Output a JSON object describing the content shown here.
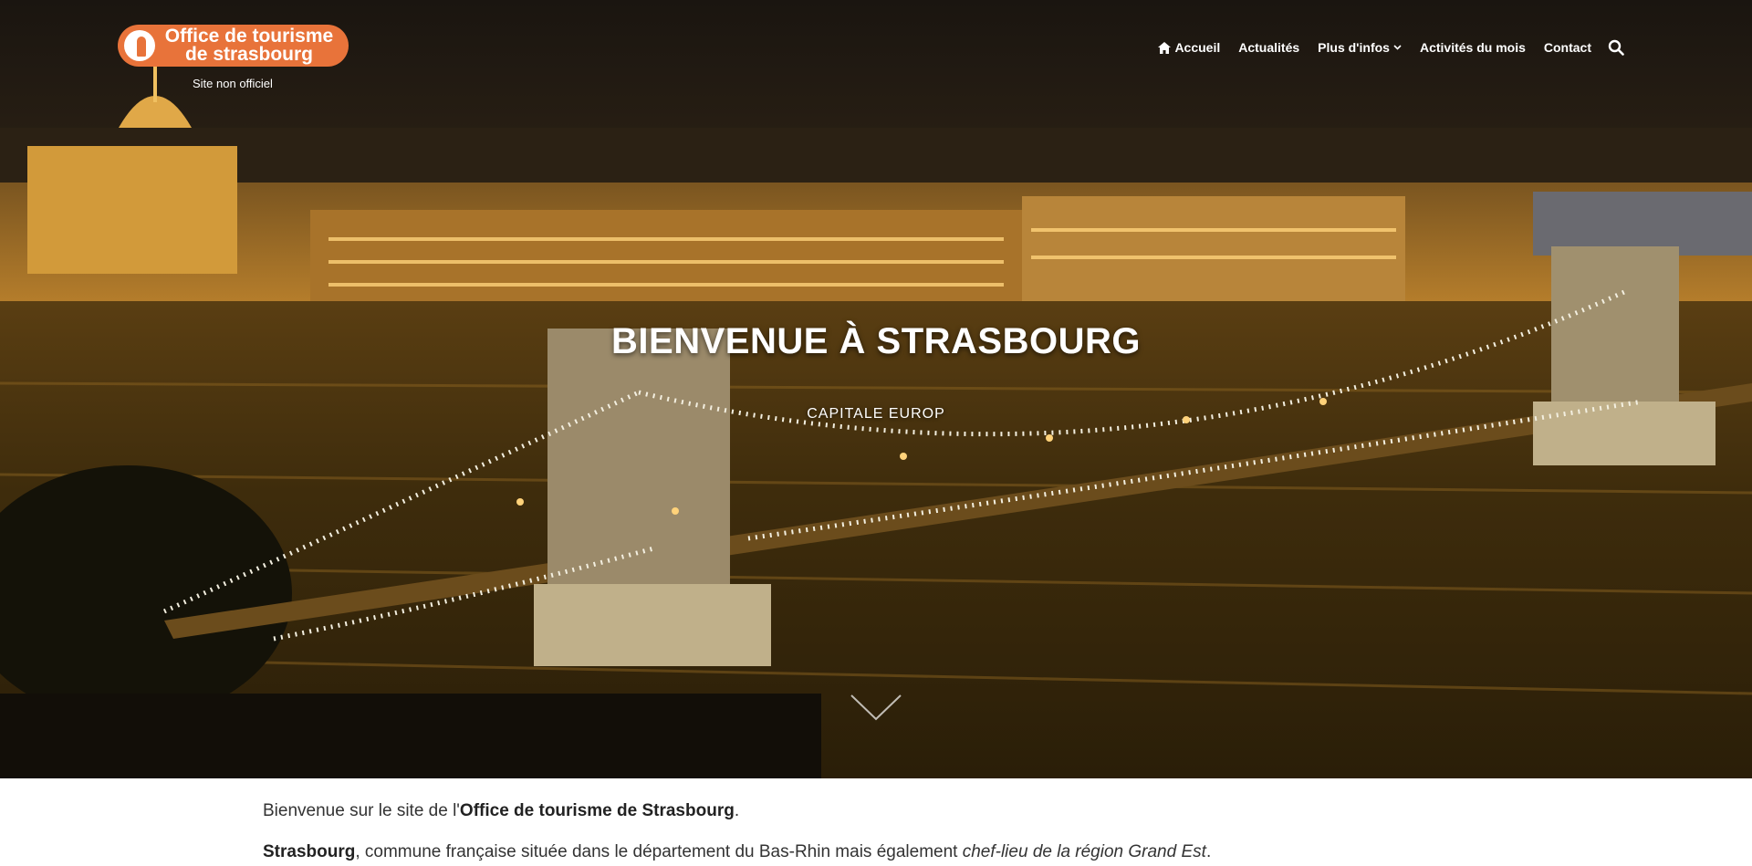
{
  "brand": {
    "logo_text": "Office de tourisme de strasbourg",
    "tagline": "Site non officiel",
    "color": "#e8733a"
  },
  "nav": {
    "home": {
      "label": "Accueil",
      "icon": "home-icon"
    },
    "news": {
      "label": "Actualités"
    },
    "more": {
      "label": "Plus d'infos",
      "icon": "chevron-down-icon"
    },
    "activities": {
      "label": "Activités du mois"
    },
    "contact": {
      "label": "Contact"
    },
    "search": {
      "icon": "search-icon"
    }
  },
  "hero": {
    "title": "BIENVENUE À STRASBOURG",
    "subtitle": "CAPITALE EUROP",
    "scroll_icon": "chevron-down-icon"
  },
  "content": {
    "p1": {
      "before": "Bienvenue sur le site de l'",
      "bold": "Office de tourisme de Strasbourg",
      "after": "."
    },
    "p2": {
      "bold": "Strasbourg",
      "middle": ", commune française située dans le département du Bas-Rhin mais également ",
      "italic": "chef-lieu de la région Grand Est",
      "after": "."
    }
  }
}
